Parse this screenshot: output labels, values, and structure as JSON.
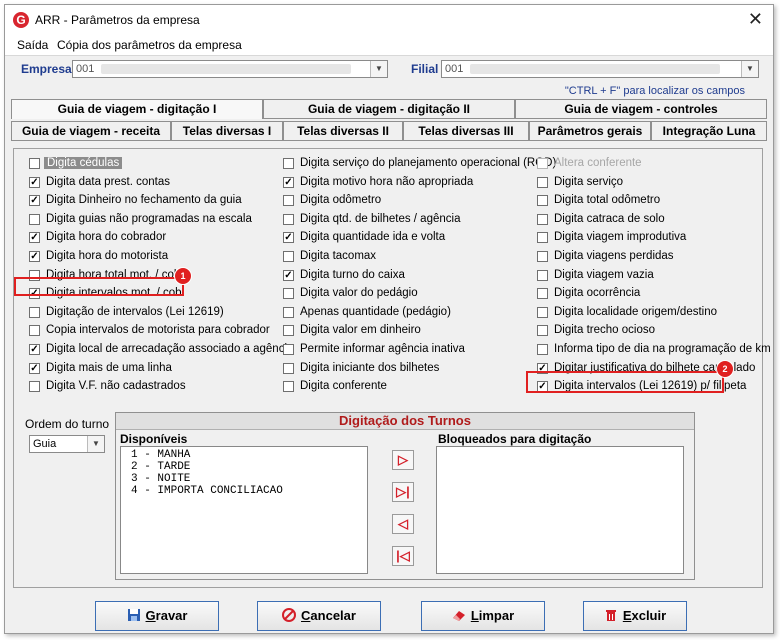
{
  "window": {
    "title": "ARR - Parâmetros da empresa",
    "app_letter": "G",
    "close": "✕"
  },
  "menu": [
    "Saída",
    "Cópia dos parâmetros da empresa"
  ],
  "empresa": {
    "label": "Empresa",
    "value": "001"
  },
  "filial": {
    "label": "Filial",
    "value": "001"
  },
  "hint": "\"CTRL + F\" para localizar os campos",
  "tabs_row1": [
    "Guia de viagem - digitação I",
    "Guia de viagem - digitação II",
    "Guia de viagem - controles"
  ],
  "tabs_row2": [
    "Guia de viagem - receita",
    "Telas diversas I",
    "Telas diversas II",
    "Telas diversas III",
    "Parâmetros gerais",
    "Integração Luna"
  ],
  "col1": [
    {
      "label": "Digita cédulas",
      "checked": false
    },
    {
      "label": "Digita data prest. contas",
      "checked": true
    },
    {
      "label": "Digita Dinheiro no fechamento da guia",
      "checked": true
    },
    {
      "label": "Digita guias não programadas na escala",
      "checked": false
    },
    {
      "label": "Digita hora do cobrador",
      "checked": true
    },
    {
      "label": "Digita hora do motorista",
      "checked": true
    },
    {
      "label": "Digita hora total mot. / cob.",
      "checked": false
    },
    {
      "label": "Digita  intervalos mot. / cob.",
      "checked": true
    },
    {
      "label": "Digitação de intervalos (Lei 12619)",
      "checked": false
    },
    {
      "label": "Copia intervalos de motorista para cobrador",
      "checked": false
    },
    {
      "label": "Digita local de arrecadação associado a agência",
      "checked": true
    },
    {
      "label": "Digita mais de uma linha",
      "checked": true
    },
    {
      "label": "Digita V.F. não cadastrados",
      "checked": false
    }
  ],
  "col2": [
    {
      "label": "Digita serviço do planejamento operacional (ROD)",
      "checked": false
    },
    {
      "label": "Digita motivo hora não apropriada",
      "checked": true
    },
    {
      "label": "Digita odômetro",
      "checked": false
    },
    {
      "label": "Digita qtd. de bilhetes / agência",
      "checked": false
    },
    {
      "label": "Digita quantidade ida e volta",
      "checked": true
    },
    {
      "label": "Digita tacomax",
      "checked": false
    },
    {
      "label": "Digita turno do caixa",
      "checked": true
    },
    {
      "label": "Digita valor do pedágio",
      "checked": false
    },
    {
      "label": "Apenas quantidade (pedágio)",
      "checked": false
    },
    {
      "label": "Digita valor em dinheiro",
      "checked": false
    },
    {
      "label": "Permite informar agência inativa",
      "checked": false
    },
    {
      "label": "Digita iniciante dos bilhetes",
      "checked": false
    },
    {
      "label": "Digita conferente",
      "checked": false
    }
  ],
  "col3": [
    {
      "label": "Altera conferente",
      "checked": false,
      "disabled": true
    },
    {
      "label": "Digita serviço",
      "checked": false
    },
    {
      "label": "Digita total odômetro",
      "checked": false
    },
    {
      "label": "Digita catraca de solo",
      "checked": false
    },
    {
      "label": "Digita viagem improdutiva",
      "checked": false
    },
    {
      "label": "Digita viagens perdidas",
      "checked": false
    },
    {
      "label": "Digita viagem vazia",
      "checked": false
    },
    {
      "label": "Digita ocorrência",
      "checked": false
    },
    {
      "label": "Digita localidade origem/destino",
      "checked": false
    },
    {
      "label": "Digita trecho ocioso",
      "checked": false
    },
    {
      "label": "Informa tipo de dia na programação de km",
      "checked": false
    },
    {
      "label": "Digitar justificativa do bilhete cancelado",
      "checked": true
    },
    {
      "label": "Digita intervalos (Lei 12619) p/ filipeta",
      "checked": true
    }
  ],
  "badges": [
    "1",
    "2"
  ],
  "ordem": {
    "label": "Ordem do turno",
    "value": "Guia"
  },
  "turnos": {
    "title": "Digitação dos Turnos",
    "disponiveis_label": "Disponíveis",
    "bloqueados_label": "Bloqueados para digitação",
    "disponiveis": [
      "1 - MANHA",
      "2 - TARDE",
      "3 - NOITE",
      "4 - IMPORTA CONCILIACAO"
    ],
    "arrows": [
      "▷",
      "▷|",
      "◁",
      "|◁"
    ]
  },
  "buttons": [
    {
      "key": "G",
      "rest": "ravar"
    },
    {
      "key": "C",
      "rest": "ancelar"
    },
    {
      "key": "L",
      "rest": "impar"
    },
    {
      "key": "E",
      "rest": "xcluir"
    }
  ]
}
